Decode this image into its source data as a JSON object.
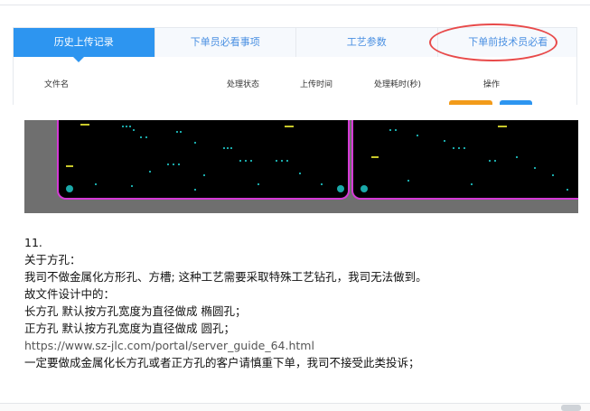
{
  "tabs": [
    {
      "label": "历史上传记录",
      "active": true
    },
    {
      "label": "下单员必看事项",
      "active": false
    },
    {
      "label": "工艺参数",
      "active": false
    },
    {
      "label": "下单前技术员必看",
      "active": false
    }
  ],
  "table": {
    "columns": [
      "文件名",
      "处理状态",
      "上传时间",
      "处理耗时(秒)",
      "操作"
    ]
  },
  "colors": {
    "tab_active": "#2d95f0",
    "tab_text": "#4a90e2",
    "annotation": "#e84a4a",
    "board_outline": "#d53ad6",
    "action_orange": "#f29b1a",
    "action_blue": "#2d95f0"
  },
  "content": {
    "lines": [
      "11.",
      "关于方孔：",
      "我司不做金属化方形孔、方槽; 这种工艺需要采取特殊工艺钻孔，我司无法做到。",
      "故文件设计中的：",
      "长方孔 默认按方孔宽度为直径做成 椭圆孔；",
      "正方孔 默认按方孔宽度为直径做成 圆孔；",
      "https://www.sz-jlc.com/portal/server_guide_64.html",
      "一定要做成金属化长方孔或者正方孔的客户请慎重下单，我司不接受此类投诉；"
    ]
  }
}
